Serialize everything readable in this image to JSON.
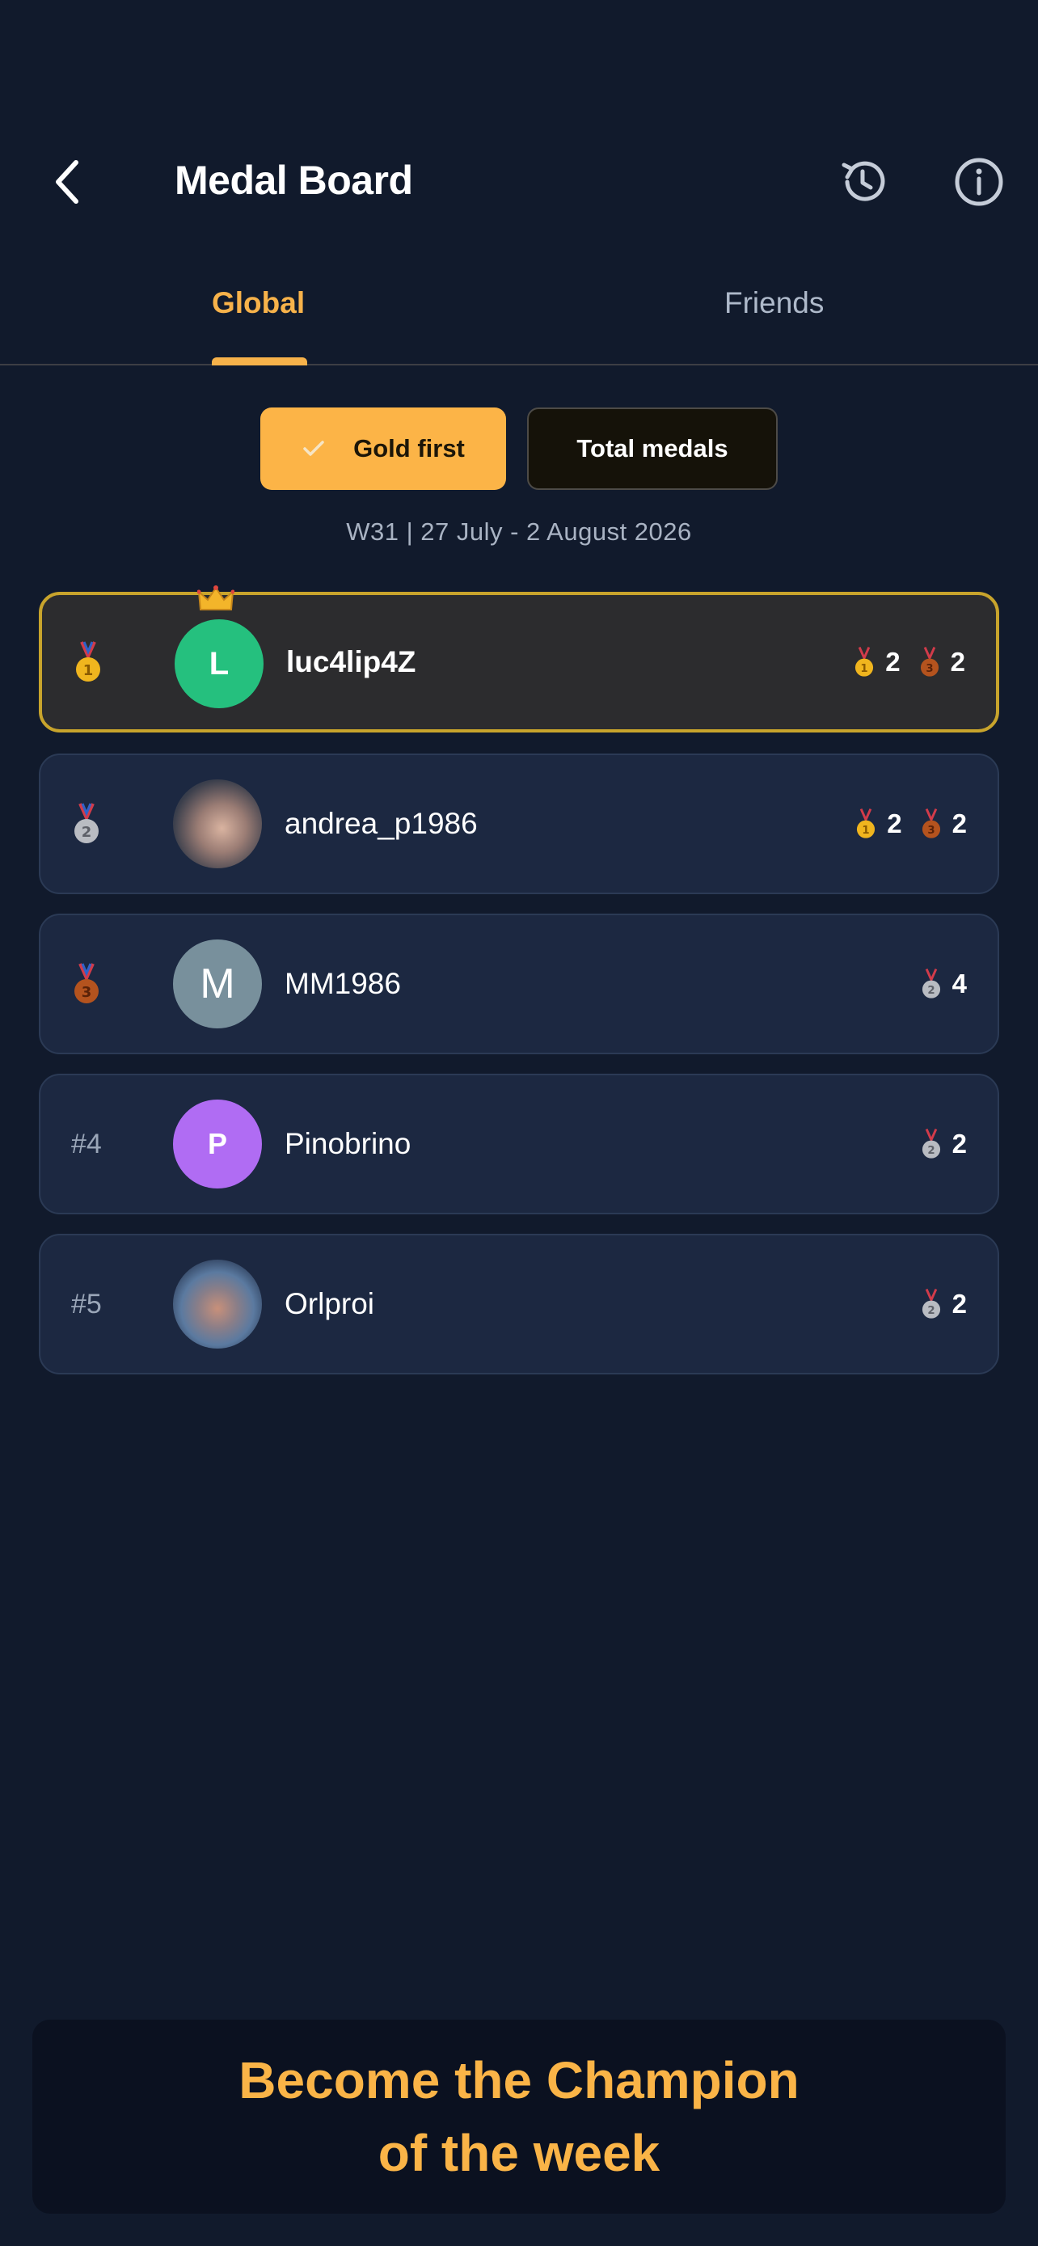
{
  "header": {
    "title": "Medal Board",
    "back_icon": "chevron-left-icon",
    "history_icon": "history-icon",
    "info_icon": "info-icon"
  },
  "tabs": [
    {
      "label": "Global",
      "active": true
    },
    {
      "label": "Friends",
      "active": false
    }
  ],
  "filters": {
    "gold_first": "Gold first",
    "total_medals": "Total medals",
    "selected": "gold_first"
  },
  "week_label": "W31 | 27 July - 2 August 2026",
  "colors": {
    "background": "#111a2c",
    "accent": "#f7b24a",
    "row": "#1c2841",
    "top_row": "#2c2c2e",
    "top_border": "#c8a42c"
  },
  "leaderboard": [
    {
      "rank_label": "",
      "rank_medal": "gold",
      "username": "luc4lip4Z",
      "avatar_initial": "L",
      "avatar_color": "#25c07e",
      "champion_crown": true,
      "medals": [
        {
          "type": "gold",
          "count": "2"
        },
        {
          "type": "bronze",
          "count": "2"
        }
      ]
    },
    {
      "rank_label": "",
      "rank_medal": "silver",
      "username": "andrea_p1986",
      "avatar_initial": "",
      "avatar_color": "photo",
      "champion_crown": false,
      "medals": [
        {
          "type": "gold",
          "count": "2"
        },
        {
          "type": "bronze",
          "count": "2"
        }
      ]
    },
    {
      "rank_label": "",
      "rank_medal": "bronze",
      "username": "MM1986",
      "avatar_initial": "M",
      "avatar_color": "#78909c",
      "champion_crown": false,
      "medals": [
        {
          "type": "silver",
          "count": "4"
        }
      ]
    },
    {
      "rank_label": "#4",
      "rank_medal": "",
      "username": "Pinobrino",
      "avatar_initial": "P",
      "avatar_color": "#b06cf3",
      "champion_crown": false,
      "medals": [
        {
          "type": "silver",
          "count": "2"
        }
      ]
    },
    {
      "rank_label": "#5",
      "rank_medal": "",
      "username": "Orlproi",
      "avatar_initial": "",
      "avatar_color": "photo",
      "champion_crown": false,
      "medals": [
        {
          "type": "silver",
          "count": "2"
        }
      ]
    }
  ],
  "banner": {
    "line1": "Become the Champion",
    "line2": "of the week"
  }
}
